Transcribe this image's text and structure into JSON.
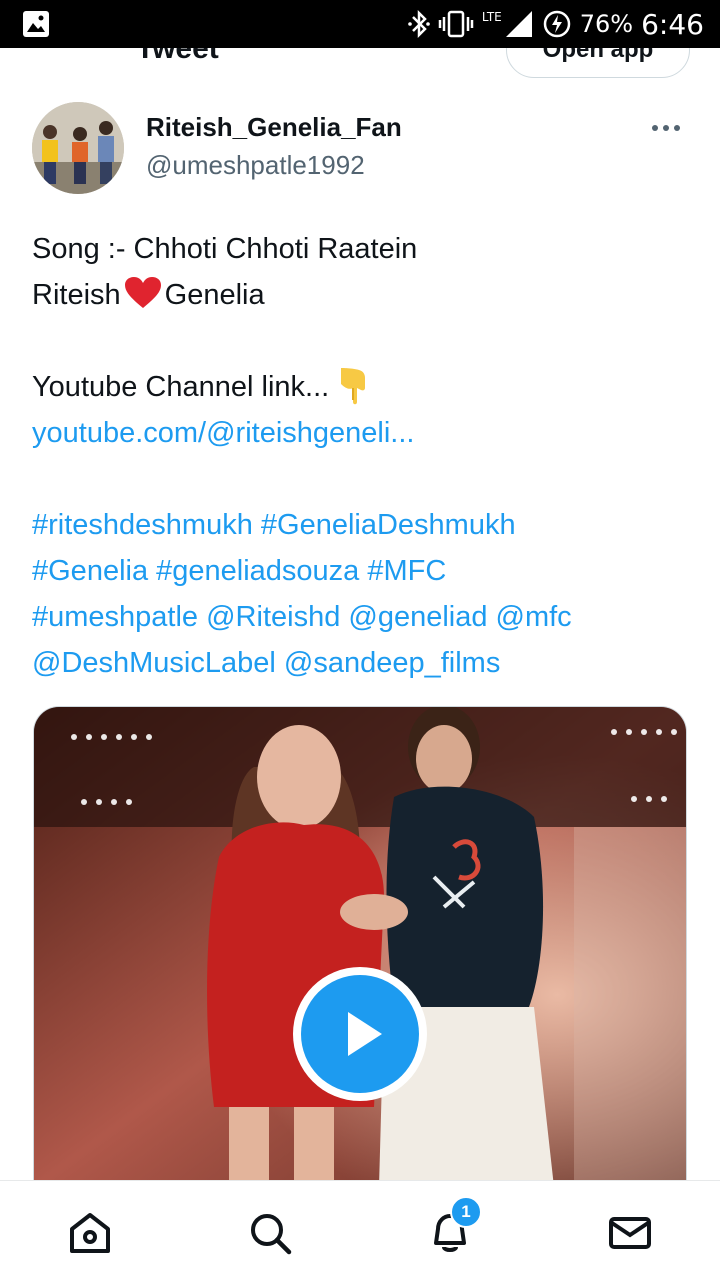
{
  "status_bar": {
    "network": "LTE",
    "battery": "76%",
    "time": "6:46",
    "icons": [
      "image-icon",
      "bluetooth-icon",
      "vibrate-icon",
      "signal-icon",
      "battery-icon"
    ]
  },
  "header": {
    "title": "Tweet",
    "open_app_label": "Open app"
  },
  "author": {
    "name": "Riteish_Genelia_Fan",
    "handle": "@umeshpatle1992"
  },
  "tweet": {
    "line1": "Song :- Chhoti Chhoti Raatein",
    "line2_a": "Riteish",
    "line2_b": "Genelia",
    "line3": "Youtube Channel link...",
    "line4": "youtube.com/@riteishgeneli...",
    "tags_line1": "#riteshdeshmukh #GeneliaDeshmukh",
    "tags_line2": "#Genelia #geneliadsouza #MFC",
    "tags_line3": "#umeshpatle @Riteishd @geneliad @mfc",
    "tags_line4": "@DeshMusicLabel @sandeep_films"
  },
  "bottom_nav": {
    "items": [
      "home-icon",
      "search-icon",
      "notifications-icon",
      "messages-icon"
    ],
    "notification_count": "1"
  },
  "colors": {
    "accent": "#1d9bf0",
    "text": "#0f1419",
    "secondary_text": "#536471",
    "heart": "#e0242f"
  }
}
